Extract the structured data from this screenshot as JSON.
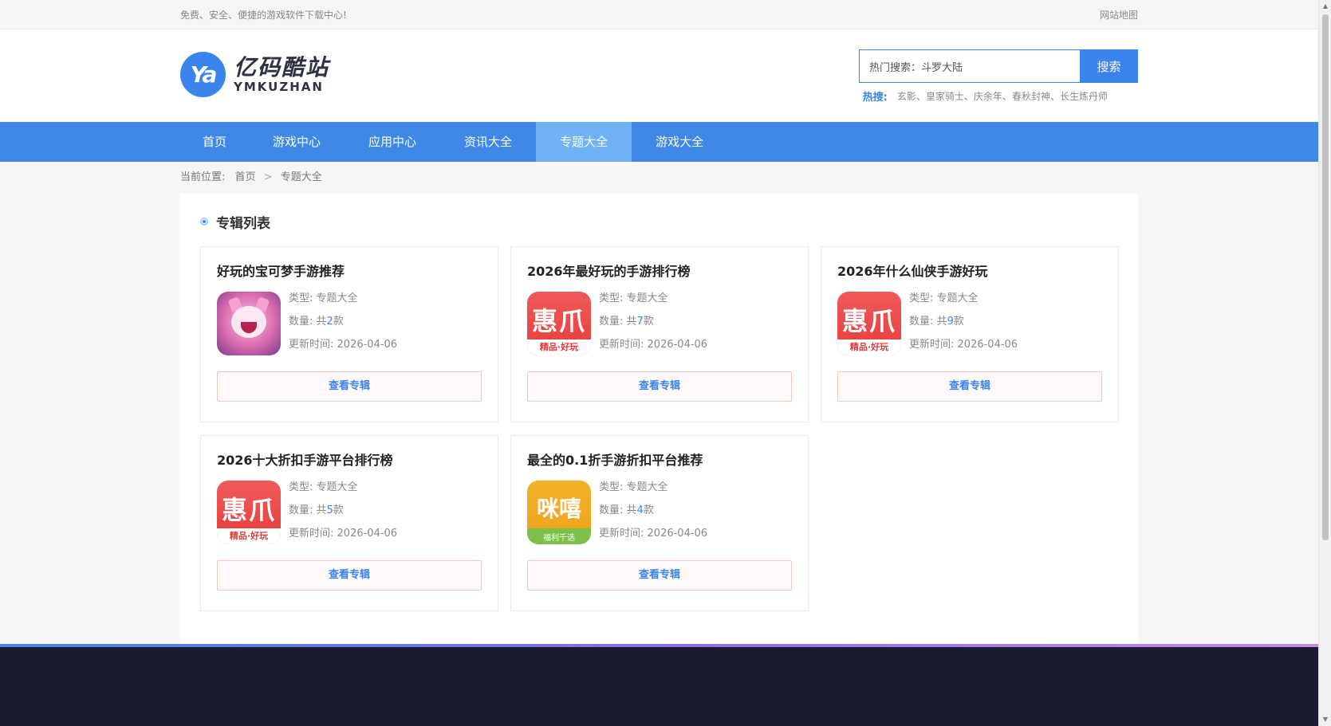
{
  "topbar": {
    "slogan": "免费、安全、便捷的游戏软件下载中心!",
    "sitemap": "网站地图"
  },
  "header": {
    "logo_mark": "Ya",
    "logo_cn": "亿码酷站",
    "logo_en": "YMKUZHAN",
    "search_value": "热门搜索：斗罗大陆",
    "search_button": "搜索",
    "hot_label": "热搜:",
    "hot_terms": [
      "玄影",
      "皇家骑士",
      "庆余年",
      "春秋封神",
      "长生炼丹师"
    ],
    "hot_sep": "、"
  },
  "nav": {
    "items": [
      {
        "label": "首页"
      },
      {
        "label": "游戏中心"
      },
      {
        "label": "应用中心"
      },
      {
        "label": "资讯大全"
      },
      {
        "label": "专题大全"
      },
      {
        "label": "游戏大全"
      }
    ],
    "active_index": 4
  },
  "breadcrumb": {
    "prefix": "当前位置:",
    "home": "首页",
    "sep": ">",
    "current": "专题大全"
  },
  "panel": {
    "title": "专辑列表"
  },
  "cards": [
    {
      "title": "好玩的宝可梦手游推荐",
      "thumb": "pink-cat-icon",
      "type_label": "类型:",
      "type_value": "专题大全",
      "count_label": "数量:",
      "count_prefix": "共",
      "count": "2",
      "count_suffix": "款",
      "date_label": "更新时间:",
      "date": "2026-04-06",
      "button": "查看专辑"
    },
    {
      "title": "2026年最好玩的手游排行榜",
      "thumb": "huizhua-icon",
      "thumb_text": "惠爪",
      "thumb_strip": "精品·好玩",
      "type_label": "类型:",
      "type_value": "专题大全",
      "count_label": "数量:",
      "count_prefix": "共",
      "count": "7",
      "count_suffix": "款",
      "date_label": "更新时间:",
      "date": "2026-04-06",
      "button": "查看专辑"
    },
    {
      "title": "2026年什么仙侠手游好玩",
      "thumb": "huizhua-icon",
      "thumb_text": "惠爪",
      "thumb_strip": "精品·好玩",
      "type_label": "类型:",
      "type_value": "专题大全",
      "count_label": "数量:",
      "count_prefix": "共",
      "count": "9",
      "count_suffix": "款",
      "date_label": "更新时间:",
      "date": "2026-04-06",
      "button": "查看专辑"
    },
    {
      "title": "2026十大折扣手游平台排行榜",
      "thumb": "huizhua-icon",
      "thumb_text": "惠爪",
      "thumb_strip": "精品·好玩",
      "type_label": "类型:",
      "type_value": "专题大全",
      "count_label": "数量:",
      "count_prefix": "共",
      "count": "5",
      "count_suffix": "款",
      "date_label": "更新时间:",
      "date": "2026-04-06",
      "button": "查看专辑"
    },
    {
      "title": "最全的0.1折手游折扣平台推荐",
      "thumb": "mixi-icon",
      "thumb_text": "咪嘻",
      "thumb_strip": "福利千选",
      "type_label": "类型:",
      "type_value": "专题大全",
      "count_label": "数量:",
      "count_prefix": "共",
      "count": "4",
      "count_suffix": "款",
      "date_label": "更新时间:",
      "date": "2026-04-06",
      "button": "查看专辑"
    }
  ],
  "colors": {
    "accent": "#3a84ec",
    "nav_bg": "#3f88e6",
    "nav_active": "#6fb3f5",
    "footer_bg": "#1b1b2f"
  }
}
